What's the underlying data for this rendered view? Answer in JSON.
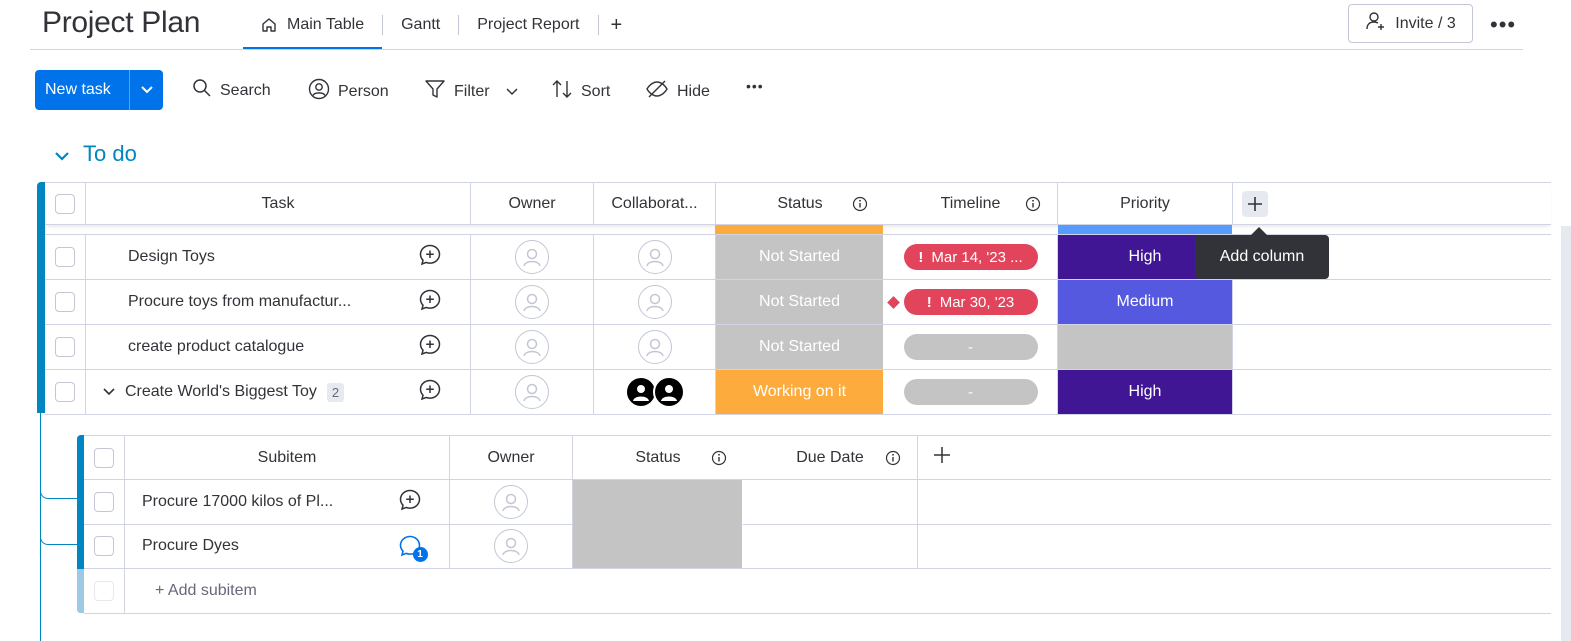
{
  "header": {
    "title": "Project Plan",
    "tabs": [
      {
        "label": "Main Table",
        "icon": "home-icon",
        "active": true
      },
      {
        "label": "Gantt"
      },
      {
        "label": "Project Report"
      }
    ],
    "add_tab": "+",
    "invite_label": "Invite / 3",
    "more": "•••"
  },
  "toolbar": {
    "new_task": "New task",
    "search": "Search",
    "person": "Person",
    "filter": "Filter",
    "sort": "Sort",
    "hide": "Hide",
    "more": "•••"
  },
  "group": {
    "title": "To do",
    "color": "#0086c0",
    "columns": [
      "Task",
      "Owner",
      "Collaborat...",
      "Status",
      "Timeline",
      "Priority"
    ],
    "add_column_tooltip": "Add column",
    "rows": [
      {
        "task": "Design Toys",
        "status": "Not Started",
        "timeline": "Mar 14, '23 ...",
        "timeline_alert": true,
        "priority": "High"
      },
      {
        "task": "Procure toys from manufactur...",
        "status": "Not Started",
        "timeline": "Mar 30, '23",
        "timeline_alert": true,
        "priority": "Medium"
      },
      {
        "task": "create product catalogue",
        "status": "Not Started",
        "timeline": "-",
        "timeline_alert": false,
        "priority": ""
      },
      {
        "task": "Create World's Biggest Toy",
        "subitem_count": "2",
        "status": "Working on it",
        "timeline": "-",
        "timeline_alert": false,
        "priority": "High"
      }
    ]
  },
  "subitems": {
    "columns": [
      "Subitem",
      "Owner",
      "Status",
      "Due Date"
    ],
    "rows": [
      {
        "name": "Procure 17000 kilos of Pl...",
        "updates": ""
      },
      {
        "name": "Procure Dyes",
        "updates": "1"
      }
    ],
    "add_label": "+ Add subitem"
  },
  "colors": {
    "accent": "#0073ea",
    "not_started": "#c4c4c4",
    "working": "#fdab3d",
    "high": "#401694",
    "medium": "#5559df",
    "alert": "#e2445c"
  }
}
